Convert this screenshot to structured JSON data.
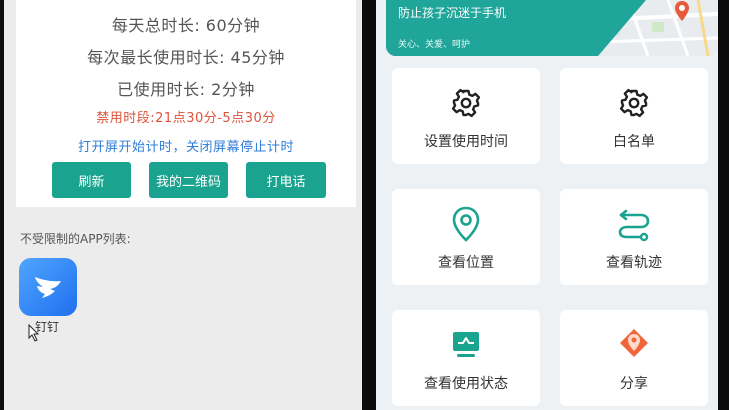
{
  "left_screen": {
    "usage": {
      "daily_total": "每天总时长: 60分钟",
      "max_single": "每次最长使用时长: 45分钟",
      "used": "已使用时长: 2分钟",
      "forbidden": "禁用时段:21点30分-5点30分",
      "note": "打开屏开始计时，关闭屏幕停止计时"
    },
    "buttons": {
      "refresh": "刷新",
      "qrcode": "我的二维码",
      "call": "打电话"
    },
    "unlimited_apps": {
      "label": "不受限制的APP列表:",
      "apps": [
        {
          "name": "钉钉",
          "icon": "dingtalk-icon"
        }
      ]
    }
  },
  "right_screen": {
    "banner": {
      "title": "防止孩子沉迷于手机",
      "subtitle": "关心、关爱、呵护"
    },
    "menu": [
      {
        "label": "设置使用时间",
        "icon": "gear-icon"
      },
      {
        "label": "白名单",
        "icon": "gear-icon"
      },
      {
        "label": "查看位置",
        "icon": "location-pin-icon"
      },
      {
        "label": "查看轨迹",
        "icon": "route-icon"
      },
      {
        "label": "查看使用状态",
        "icon": "monitor-icon"
      },
      {
        "label": "分享",
        "icon": "share-icon"
      }
    ]
  },
  "colors": {
    "accent_green": "#1aa38e",
    "forbidden_red": "#e0533a",
    "note_blue": "#2f7ed8",
    "banner_teal": "#20a59a",
    "share_orange": "#f0663a"
  }
}
